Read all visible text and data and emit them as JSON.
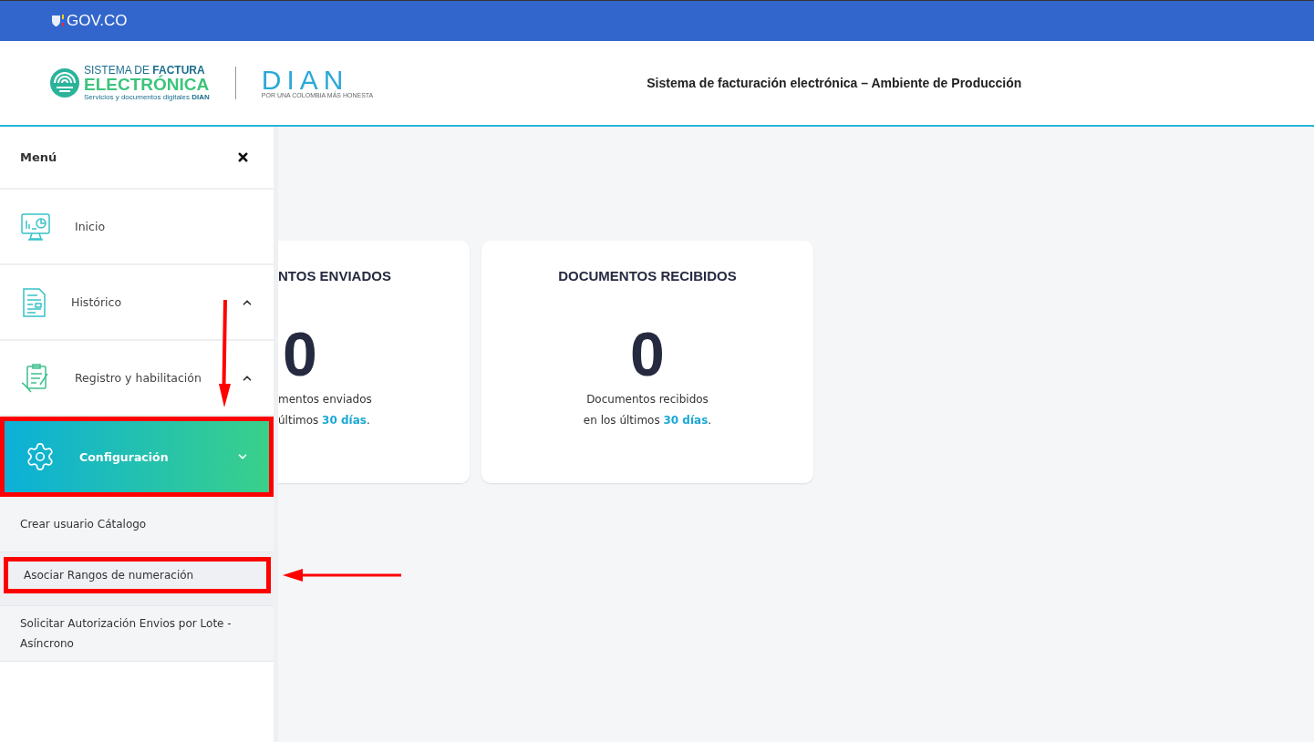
{
  "gov_bar": {
    "brand": "GOV.CO"
  },
  "header": {
    "logo": {
      "line1": "SISTEMA DE **FACTURA**",
      "line2": "ELECTRÓNICA",
      "line3": "Servicios y documentos digitales **DIAN**"
    },
    "dian_logo": {
      "name": "DIAN",
      "tagline": "POR UNA COLOMBIA MÁS HONESTA"
    },
    "title": "Sistema de facturación electrónica – Ambiente de Producción"
  },
  "menu": {
    "title": "Menú",
    "items": [
      {
        "label": "Inicio",
        "kind": "link",
        "expanded": false,
        "highlighted": false
      },
      {
        "label": "Histórico",
        "kind": "group",
        "expanded": false,
        "highlighted": false
      },
      {
        "label": "Registro y habilitación",
        "kind": "group",
        "expanded": false,
        "highlighted": false
      },
      {
        "label": "Configuración",
        "kind": "group",
        "expanded": true,
        "highlighted": true,
        "annotation": {
          "kind": "down-arrow"
        },
        "children": [
          {
            "label": "Crear usuario Cátalogo",
            "selected": false,
            "highlighted": false
          },
          {
            "label": "Asociar Rangos de numeración",
            "selected": true,
            "highlighted": true,
            "annotation": {
              "kind": "left-arrow"
            }
          },
          {
            "label": "Solicitar Autorización Envios por Lote - Asíncrono",
            "selected": false,
            "highlighted": false
          }
        ]
      }
    ]
  },
  "cards": [
    {
      "title": "NTOS ENVIADOS",
      "count": "0",
      "caption_line1": "mentos enviados",
      "caption_line2": "últimos **30 días**.",
      "cut": true
    },
    {
      "title": "DOCUMENTOS RECIBIDOS",
      "count": "0",
      "caption_line1": "Documentos recibidos",
      "caption_line2": "en los últimos **30 días**.",
      "cut": false
    }
  ]
}
